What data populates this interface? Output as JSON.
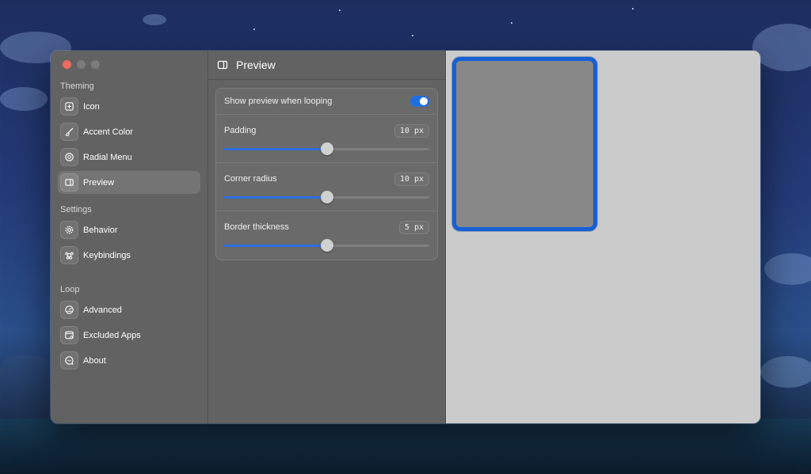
{
  "window": {
    "traffic_lights": [
      "close",
      "minimize",
      "zoom"
    ]
  },
  "sidebar": {
    "sections": [
      {
        "label": "Theming",
        "items": [
          {
            "label": "Icon",
            "icon": "plus-square-icon"
          },
          {
            "label": "Accent Color",
            "icon": "paintbrush-icon"
          },
          {
            "label": "Radial Menu",
            "icon": "radial-circle-icon"
          },
          {
            "label": "Preview",
            "icon": "sidebar-preview-icon",
            "active": true
          }
        ]
      },
      {
        "label": "Settings",
        "items": [
          {
            "label": "Behavior",
            "icon": "gear-icon"
          },
          {
            "label": "Keybindings",
            "icon": "command-key-icon"
          }
        ]
      },
      {
        "label": "Loop",
        "items": [
          {
            "label": "Advanced",
            "icon": "gauge-icon"
          },
          {
            "label": "Excluded Apps",
            "icon": "app-window-icon"
          },
          {
            "label": "About",
            "icon": "message-bubble-icon"
          }
        ]
      }
    ]
  },
  "toolbar": {
    "title": "Preview",
    "icon": "sidebar-preview-icon"
  },
  "settings": {
    "show_preview": {
      "label": "Show preview when looping",
      "enabled": true
    },
    "padding": {
      "label": "Padding",
      "value_text": "10 px",
      "value": 10,
      "fraction": 0.5
    },
    "corner_radius": {
      "label": "Corner radius",
      "value_text": "10 px",
      "value": 10,
      "fraction": 0.5
    },
    "border_thickness": {
      "label": "Border thickness",
      "value_text": "5 px",
      "value": 5,
      "fraction": 0.5
    }
  },
  "colors": {
    "accent": "#1f6fe0",
    "preview_border": "#1560d4",
    "preview_fill": "#888888",
    "preview_background": "#cbcbcb"
  }
}
